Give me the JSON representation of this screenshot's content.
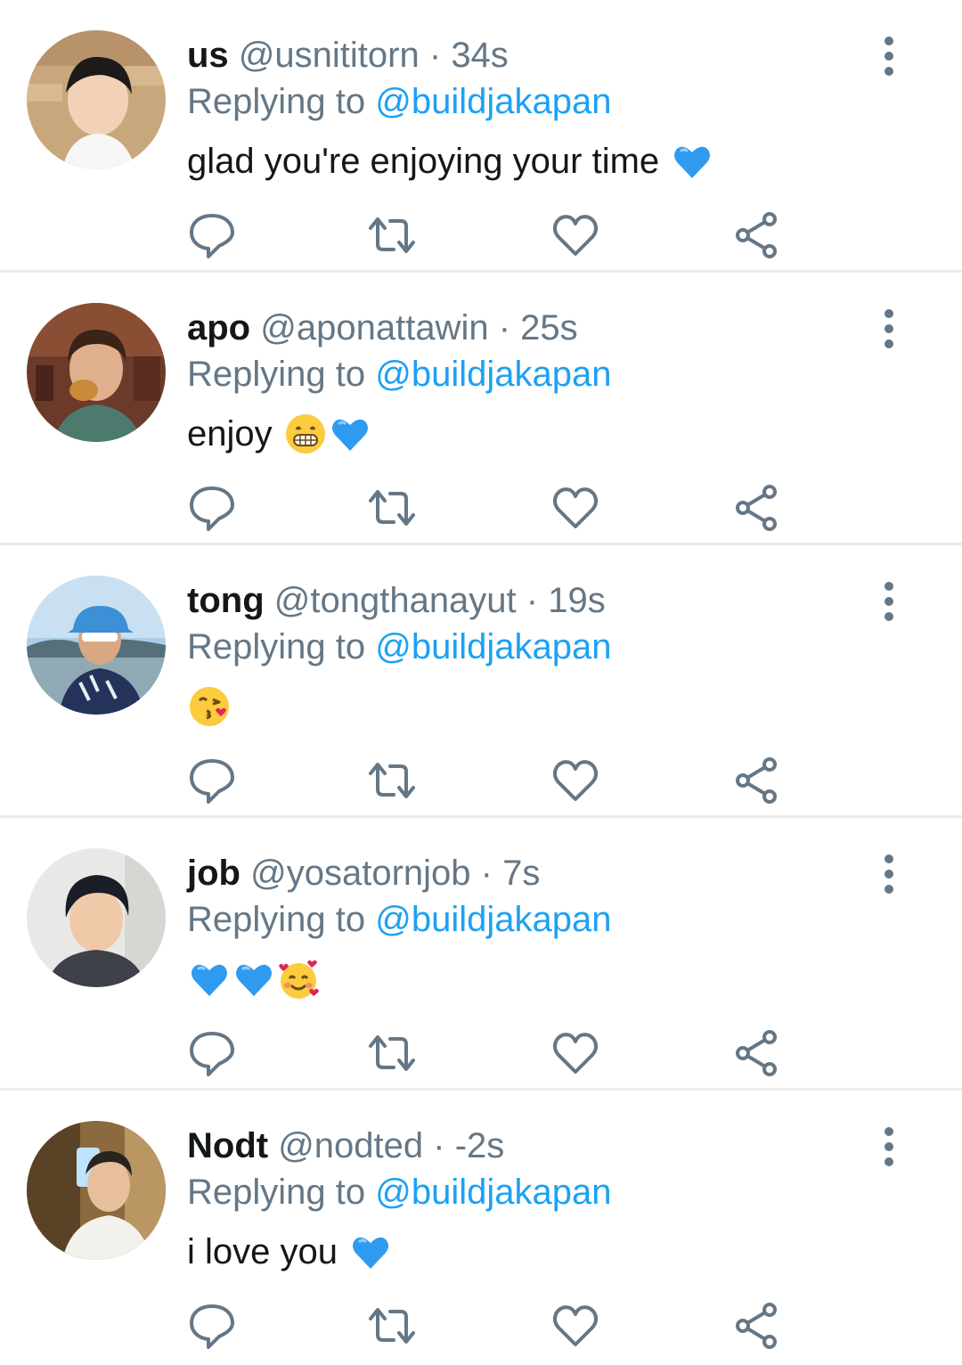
{
  "colors": {
    "text": "#14171a",
    "secondary": "#657786",
    "mention": "#1da1f2",
    "divider": "#e6ecf0",
    "icon": "#657786"
  },
  "tweets": [
    {
      "name": "us",
      "handle": "@usnititorn",
      "separator": "·",
      "time": "34s",
      "replying_prefix": "Replying to",
      "replying_to": "@buildjakapan",
      "text": "glad you're enjoying your time",
      "emojis": [
        "blue-heart"
      ]
    },
    {
      "name": "apo",
      "handle": "@aponattawin",
      "separator": "·",
      "time": "25s",
      "replying_prefix": "Replying to",
      "replying_to": "@buildjakapan",
      "text": "enjoy",
      "emojis": [
        "grinning-face",
        "blue-heart"
      ]
    },
    {
      "name": "tong",
      "handle": "@tongthanayut",
      "separator": "·",
      "time": "19s",
      "replying_prefix": "Replying to",
      "replying_to": "@buildjakapan",
      "text": "",
      "emojis": [
        "kissing-face"
      ]
    },
    {
      "name": "job",
      "handle": "@yosatornjob",
      "separator": "·",
      "time": "7s",
      "replying_prefix": "Replying to",
      "replying_to": "@buildjakapan",
      "text": "",
      "emojis": [
        "blue-heart",
        "blue-heart",
        "smiling-face-with-hearts"
      ]
    },
    {
      "name": "Nodt",
      "handle": "@nodted",
      "separator": "·",
      "time": "-2s",
      "replying_prefix": "Replying to",
      "replying_to": "@buildjakapan",
      "text": "i love you",
      "emojis": [
        "blue-heart"
      ]
    }
  ],
  "icons": {
    "reply": "reply-icon",
    "retweet": "retweet-icon",
    "like": "heart-icon",
    "share": "share-icon",
    "more": "more-vertical-icon"
  }
}
